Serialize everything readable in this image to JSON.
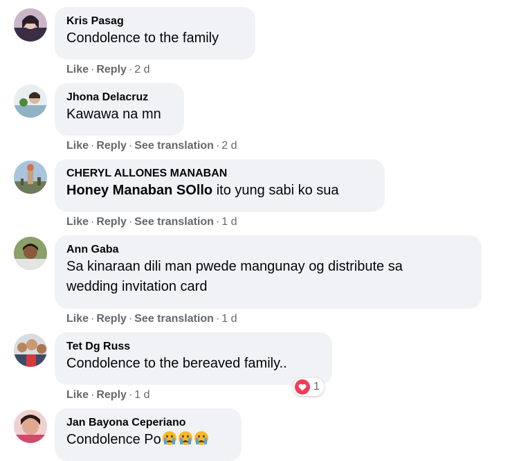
{
  "colors": {
    "bubble_bg": "#f0f2f5",
    "text": "#050505",
    "meta": "#65676b",
    "heart": "#f33e58"
  },
  "comments": [
    {
      "author": "Kris Pasag",
      "text": "Condolence to the family",
      "like": "Like",
      "reply": "Reply",
      "time": "2 d"
    },
    {
      "author": "Jhona Delacruz",
      "text": "Kawawa na mn",
      "like": "Like",
      "reply": "Reply",
      "see_translation": "See translation",
      "time": "2 d"
    },
    {
      "author": "CHERYL ALLONES MANABAN",
      "mention": "Honey Manaban SOllo",
      "text": " ito yung sabi ko sua",
      "like": "Like",
      "reply": "Reply",
      "see_translation": "See translation",
      "time": "1 d"
    },
    {
      "author": "Ann Gaba",
      "text_line1": "Sa kinaraan dili man pwede mangunay og distribute sa",
      "text_line2": "wedding invitation card",
      "like": "Like",
      "reply": "Reply",
      "see_translation": "See translation",
      "time": "1 d"
    },
    {
      "author": "Tet Dg Russ",
      "text": "Condolence to the bereaved family..",
      "like": "Like",
      "reply": "Reply",
      "time": "1 d",
      "reaction_icon": "heart-icon",
      "reaction_count": "1"
    },
    {
      "author": "Jan Bayona Ceperiano",
      "text": "Condolence Po",
      "emoji_icon": "crying-face-icon"
    }
  ]
}
